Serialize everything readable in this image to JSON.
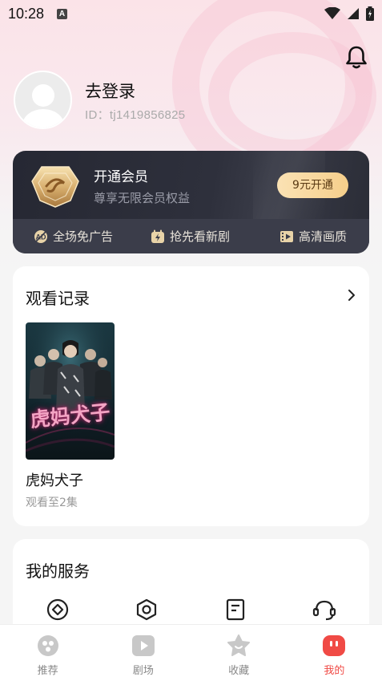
{
  "status_bar": {
    "time": "10:28",
    "notification_badge": "A",
    "icons": [
      "wifi-icon",
      "cell-signal-icon",
      "battery-charging-icon"
    ]
  },
  "header": {
    "bell_icon": "bell-icon"
  },
  "profile": {
    "login_label": "去登录",
    "user_id": "ID：tj1419856825"
  },
  "vip": {
    "title": "开通会员",
    "subtitle": "尊享无限会员权益",
    "button_label": "9元开通",
    "perks": [
      {
        "icon": "no-ads-icon",
        "label": "全场免广告"
      },
      {
        "icon": "early-access-icon",
        "label": "抢先看新剧"
      },
      {
        "icon": "hd-quality-icon",
        "label": "高清画质"
      }
    ],
    "colors": {
      "card": "#262833",
      "button": "#f6cf8b",
      "perk_text": "#e8e3da"
    }
  },
  "history": {
    "title": "观看记录",
    "items": [
      {
        "name": "虎妈犬子",
        "progress": "观看至2集",
        "poster_text": "虎妈犬子"
      }
    ]
  },
  "services": {
    "title": "我的服务",
    "icons": [
      "diamond-circle-icon",
      "hexagon-settings-icon",
      "document-icon",
      "headset-icon"
    ]
  },
  "tab_bar": {
    "tabs": [
      {
        "label": "推荐",
        "icon": "recommend-icon",
        "active": false
      },
      {
        "label": "剧场",
        "icon": "theater-play-icon",
        "active": false
      },
      {
        "label": "收藏",
        "icon": "star-favorite-icon",
        "active": false
      },
      {
        "label": "我的",
        "icon": "mine-face-icon",
        "active": true
      }
    ],
    "active_color": "#f04a45",
    "inactive_color": "#c8c8c8"
  }
}
